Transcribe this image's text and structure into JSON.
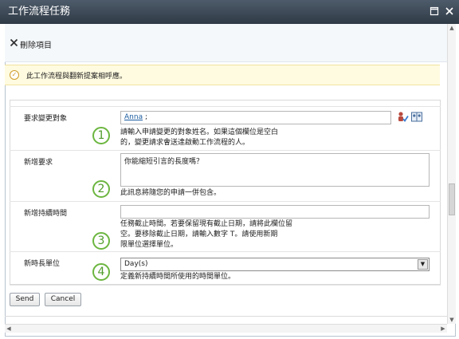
{
  "window": {
    "title": "工作流程任務"
  },
  "toolbar": {
    "delete_label": "刪除項目"
  },
  "info": {
    "message": "此工作流程與翻新提案相呼應。"
  },
  "form": {
    "assignee": {
      "label": "要求變更對象",
      "value_name": "Anna",
      "value_suffix": " ;",
      "desc_line1": "請輸入申請變更的對象姓名。如果這個欄位是空白",
      "desc_line2": "的，變更請求會送達啟動工作流程的人。",
      "step": "1"
    },
    "new_request": {
      "label": "新增要求",
      "value": "你能縮短引言的長度嗎？",
      "desc": "此訊息將隨您的申請一併包含。",
      "step": "2"
    },
    "new_duration": {
      "label": "新增持續時間",
      "value": "",
      "desc_line1": "任務截止時間。若要保留現有截止日期，請將此欄位留",
      "desc_line2": "空。要移除截止日期，請輸入數字 T。請使用新期",
      "desc_line3": "限單位選擇單位。",
      "step": "3"
    },
    "duration_unit": {
      "label": "新時長單位",
      "value": "Day(s)",
      "desc": "定義新持續時間所使用的時間單位。",
      "step": "4"
    }
  },
  "buttons": {
    "send": "Send",
    "cancel": "Cancel"
  },
  "icons": {
    "delete": "x-icon",
    "info": "check-circle-icon",
    "people_picker": "check-names-icon",
    "address_book": "address-book-icon",
    "close": "close-icon",
    "maximize": "maximize-icon"
  },
  "colors": {
    "titlebar": "#3a4654",
    "info_bar": "#fffbe0",
    "step_circle": "#6cb640",
    "link": "#1a5b9e"
  }
}
